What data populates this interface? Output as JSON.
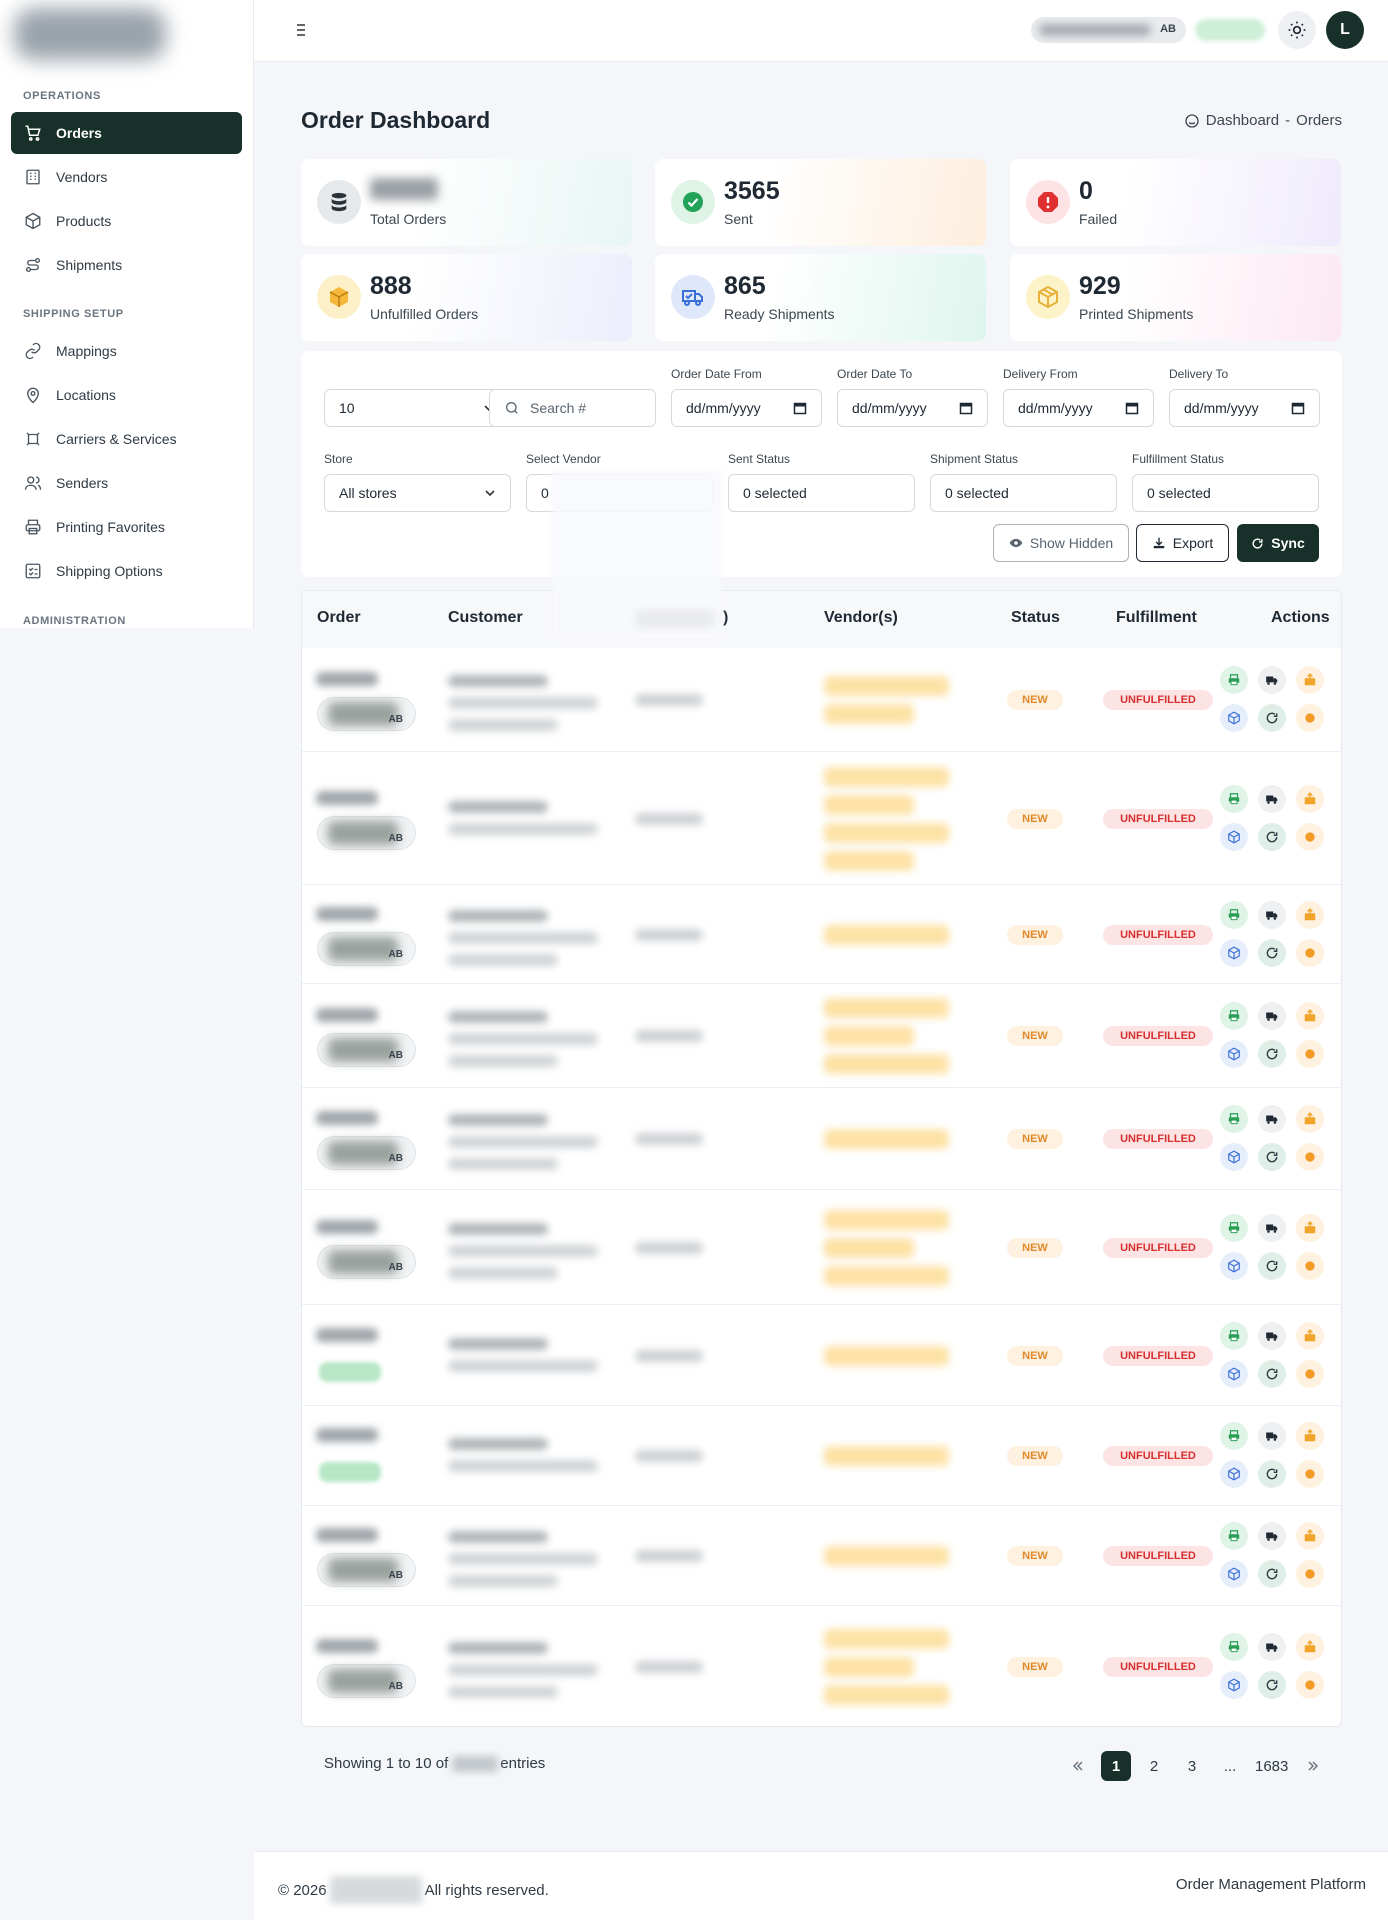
{
  "sidebar": {
    "sections": [
      "OPERATIONS",
      "SHIPPING SETUP",
      "ADMINISTRATION"
    ],
    "items": [
      {
        "label": "Orders",
        "icon": "cart-icon",
        "active": true
      },
      {
        "label": "Vendors",
        "icon": "building-icon"
      },
      {
        "label": "Products",
        "icon": "box-icon"
      },
      {
        "label": "Shipments",
        "icon": "route-icon"
      },
      {
        "label": "Mappings",
        "icon": "link-icon"
      },
      {
        "label": "Locations",
        "icon": "map-pin-icon"
      },
      {
        "label": "Carriers & Services",
        "icon": "carrier-icon"
      },
      {
        "label": "Senders",
        "icon": "users-icon"
      },
      {
        "label": "Printing Favorites",
        "icon": "printer-icon"
      },
      {
        "label": "Shipping Options",
        "icon": "checklist-icon"
      }
    ]
  },
  "topbar": {
    "user_initials": "AB",
    "avatar_letter": "L",
    "theme_icon": "sun-icon",
    "menu_icon": "hamburger-icon"
  },
  "page": {
    "title": "Order Dashboard",
    "breadcrumb": [
      "Dashboard",
      "-",
      "Orders"
    ]
  },
  "stats": [
    {
      "value": "",
      "label": "Total Orders",
      "icon": "database-icon",
      "color": "#2b3238"
    },
    {
      "value": "3565",
      "label": "Sent",
      "icon": "check-circle-icon",
      "color": "#22a35a"
    },
    {
      "value": "0",
      "label": "Failed",
      "icon": "alert-octagon-icon",
      "color": "#e03131"
    },
    {
      "value": "888",
      "label": "Unfulfilled Orders",
      "icon": "package-icon",
      "color": "#f5b83a"
    },
    {
      "value": "865",
      "label": "Ready Shipments",
      "icon": "truck-icon",
      "color": "#3b6fd8"
    },
    {
      "value": "929",
      "label": "Printed Shipments",
      "icon": "package-outline-icon",
      "color": "#e8b23a"
    }
  ],
  "filters": {
    "page_size": "10",
    "search_placeholder": "Search #",
    "order_date_from": {
      "label": "Order Date From",
      "value": "dd/mm/yyyy"
    },
    "order_date_to": {
      "label": "Order Date To",
      "value": "dd/mm/yyyy"
    },
    "delivery_from": {
      "label": "Delivery From",
      "value": "dd/mm/yyyy"
    },
    "delivery_to": {
      "label": "Delivery To",
      "value": "dd/mm/yyyy"
    },
    "store": {
      "label": "Store",
      "value": "All stores"
    },
    "vendor": {
      "label": "Select Vendor",
      "value": "0"
    },
    "sent_status": {
      "label": "Sent Status",
      "value": "0 selected"
    },
    "shipment_status": {
      "label": "Shipment Status",
      "value": "0 selected"
    },
    "fulfillment_status": {
      "label": "Fulfillment Status",
      "value": "0 selected"
    },
    "buttons": {
      "show_hidden": "Show Hidden",
      "export": "Export",
      "sync": "Sync"
    }
  },
  "table": {
    "columns": [
      "Order",
      "Customer",
      ")",
      "Vendor(s)",
      "Status",
      "Fulfillment",
      "Actions"
    ],
    "rows": [
      {
        "status": "NEW",
        "fulfillment": "UNFULFILLED",
        "badge": "AB"
      },
      {
        "status": "NEW",
        "fulfillment": "UNFULFILLED",
        "badge": "AB"
      },
      {
        "status": "NEW",
        "fulfillment": "UNFULFILLED",
        "badge": "AB"
      },
      {
        "status": "NEW",
        "fulfillment": "UNFULFILLED",
        "badge": "AB"
      },
      {
        "status": "NEW",
        "fulfillment": "UNFULFILLED",
        "badge": "AB"
      },
      {
        "status": "NEW",
        "fulfillment": "UNFULFILLED",
        "badge": "AB"
      },
      {
        "status": "NEW",
        "fulfillment": "UNFULFILLED",
        "badge": ""
      },
      {
        "status": "NEW",
        "fulfillment": "UNFULFILLED",
        "badge": ""
      },
      {
        "status": "NEW",
        "fulfillment": "UNFULFILLED",
        "badge": "AB"
      },
      {
        "status": "NEW",
        "fulfillment": "UNFULFILLED",
        "badge": "AB"
      }
    ],
    "action_icons": [
      "printer-icon",
      "truck-icon",
      "package-icon",
      "cube-icon",
      "refresh-icon",
      "circle-icon"
    ]
  },
  "pagination": {
    "showing_prefix": "Showing 1 to 10 of",
    "showing_suffix": "entries",
    "pages": [
      "1",
      "2",
      "3",
      "...",
      "1683"
    ],
    "current": "1"
  },
  "footer": {
    "copyright": "© 2026",
    "rights": "All rights reserved.",
    "platform": "Order Management Platform"
  },
  "colors": {
    "accent": "#17302a",
    "new_badge": "#e0892a",
    "unfulfilled_badge": "#d62f2f"
  }
}
